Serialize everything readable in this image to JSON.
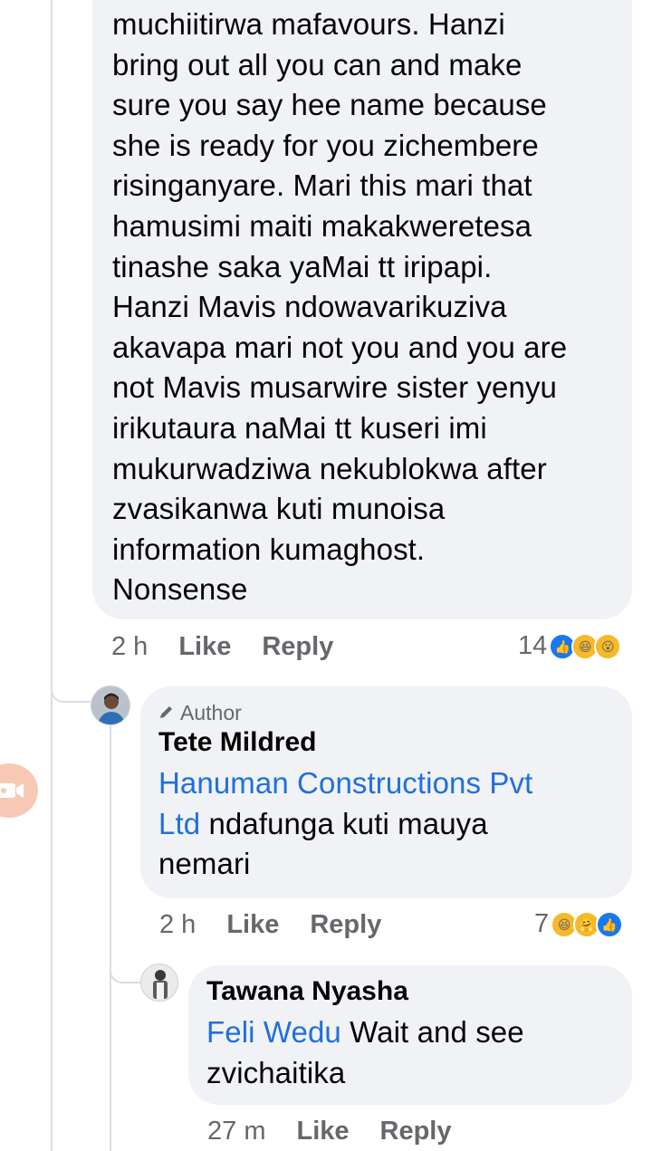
{
  "comment1": {
    "text": "muchiitirwa mafavours. Hanzi\nbring out all you can and make\nsure you say hee name because\nshe is ready for you zichembere\nrisinganyare. Mari this mari that\nhamusimi maiti makakweretesa\ntinashe saka yaMai tt iripapi.\nHanzi Mavis ndowavarikuziva\nakavapa mari not you and you are\nnot Mavis musarwire sister yenyu\nirikutaura naMai tt kuseri imi\nmukurwadziwa nekublokwa after\nzvasikanwa kuti munoisa\ninformation kumaghost.\nNonsense",
    "time": "2 h",
    "like_label": "Like",
    "reply_label": "Reply",
    "reaction_count": "14",
    "reactions": [
      "like-icon",
      "haha-icon",
      "wow-icon"
    ]
  },
  "reply1": {
    "badge": "Author",
    "author": "Tete Mildred",
    "mention": "Hanuman Constructions Pvt\nLtd",
    "text": " ndafunga kuti mauya\nnemari",
    "time": "2 h",
    "like_label": "Like",
    "reply_label": "Reply",
    "reaction_count": "7",
    "reactions": [
      "haha-icon",
      "care-icon",
      "like-icon"
    ]
  },
  "reply2": {
    "author": "Tawana Nyasha",
    "mention": "Feli Wedu",
    "text": " Wait and see\nzvichaitika",
    "time": "27 m",
    "like_label": "Like",
    "reply_label": "Reply"
  },
  "colors": {
    "bubble": "#f0f2f5",
    "meta": "#65676b",
    "mention": "#216fdb",
    "like_blue": "#1877f2",
    "emoji_yellow": "#f7b928"
  }
}
